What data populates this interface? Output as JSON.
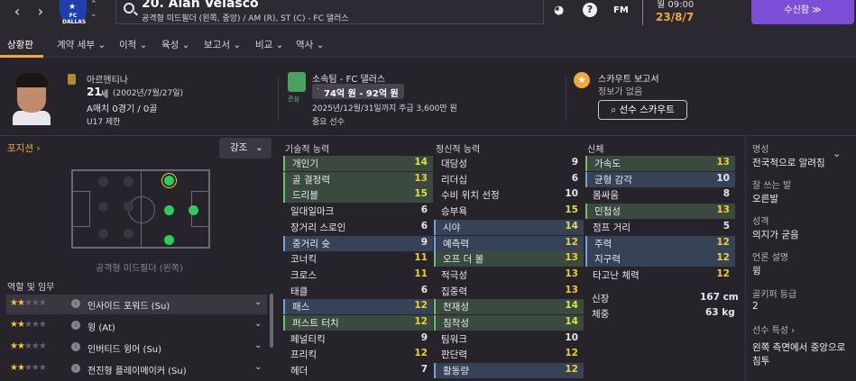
{
  "header": {
    "player_name": "20. Alan Velasco",
    "player_desc": "공격형 미드필더 (왼쪽, 중앙) / AM (R), ST (C) - FC 댈러스",
    "crest_text": "FC DALLAS",
    "fm_label": "FM",
    "date_line1": "월 09:00",
    "date_line2": "23/8/7",
    "inbox_label": "수신함 ≫"
  },
  "tabs": [
    {
      "label": "상황판"
    },
    {
      "label": "계약 세부 ⌄"
    },
    {
      "label": "이적 ⌄"
    },
    {
      "label": "육성 ⌄"
    },
    {
      "label": "보고서 ⌄"
    },
    {
      "label": "비교 ⌄"
    },
    {
      "label": "역사 ⌄"
    }
  ],
  "bio": {
    "nationality": "아르헨티나",
    "age": "21",
    "age_unit": "세",
    "dob": "(2002년/7월/27일)",
    "caps": "A매치 0경기 / 0골",
    "youth": "U17 제한"
  },
  "club": {
    "loan_label": "소속팀 - FC 댈러스",
    "badge_text": "관심",
    "value_dot": "·",
    "value": "74억 원 - 92억 원",
    "contract": "2025년/12월/31일까지 주급 3,600만 원",
    "status": "중요 선수"
  },
  "scout": {
    "title": "스카우트 보고서",
    "status": "정보가 없음",
    "button": "선수 스카우트"
  },
  "position": {
    "heading": "포지션 ›",
    "strength_btn": "강조",
    "label": "공격형 미드필더 (왼쪽)",
    "roles_heading": "역할 및 임무"
  },
  "roles": [
    {
      "name": "인사이드 포워드 (Su)",
      "stars": "2"
    },
    {
      "name": "윙 (At)",
      "stars": "2"
    },
    {
      "name": "인버티드 윙어 (Su)",
      "stars": "2"
    },
    {
      "name": "전진형 플레이메이커 (Su)",
      "stars": "2"
    }
  ],
  "technical": {
    "heading": "기술적 능력",
    "rows": [
      {
        "name": "개인기",
        "value": "14"
      },
      {
        "name": "골 결정력",
        "value": "13"
      },
      {
        "name": "드리블",
        "value": "15"
      },
      {
        "name": "일대일마크",
        "value": "6"
      },
      {
        "name": "장거리 스로인",
        "value": "6"
      },
      {
        "name": "중거리 슛",
        "value": "9"
      },
      {
        "name": "코너킥",
        "value": "11"
      },
      {
        "name": "크로스",
        "value": "11"
      },
      {
        "name": "태클",
        "value": "6"
      },
      {
        "name": "패스",
        "value": "12"
      },
      {
        "name": "퍼스트 터치",
        "value": "12"
      },
      {
        "name": "페널티킥",
        "value": "9"
      },
      {
        "name": "프리킥",
        "value": "12"
      },
      {
        "name": "헤더",
        "value": "7"
      }
    ]
  },
  "mental": {
    "heading": "정신적 능력",
    "rows": [
      {
        "name": "대담성",
        "value": "9"
      },
      {
        "name": "리더십",
        "value": "6"
      },
      {
        "name": "수비 위치 선정",
        "value": "10"
      },
      {
        "name": "승부욕",
        "value": "15"
      },
      {
        "name": "시야",
        "value": "14"
      },
      {
        "name": "예측력",
        "value": "12"
      },
      {
        "name": "오프 더 볼",
        "value": "13"
      },
      {
        "name": "적극성",
        "value": "13"
      },
      {
        "name": "집중력",
        "value": "13"
      },
      {
        "name": "천재성",
        "value": "14"
      },
      {
        "name": "침착성",
        "value": "14"
      },
      {
        "name": "팀워크",
        "value": "10"
      },
      {
        "name": "판단력",
        "value": "12"
      },
      {
        "name": "활동량",
        "value": "12"
      }
    ]
  },
  "physical": {
    "heading": "신체",
    "rows": [
      {
        "name": "가속도",
        "value": "13"
      },
      {
        "name": "균형 감각",
        "value": "10"
      },
      {
        "name": "몸싸움",
        "value": "8"
      },
      {
        "name": "민첩성",
        "value": "13"
      },
      {
        "name": "점프 거리",
        "value": "5"
      },
      {
        "name": "주력",
        "value": "12"
      },
      {
        "name": "지구력",
        "value": "12"
      },
      {
        "name": "타고난 체력",
        "value": "12"
      }
    ],
    "height_label": "신장",
    "height": "167 cm",
    "weight_label": "체중",
    "weight": "63 kg"
  },
  "side": {
    "reputation_label": "명성",
    "reputation": "전국적으로 알려짐",
    "foot_label": "잘 쓰는 발",
    "foot": "오른발",
    "personality_label": "성격",
    "personality": "의지가 굳음",
    "media_label": "언론 설명",
    "media": "윙",
    "gk_label": "골키퍼 등급",
    "gk": "2",
    "traits_label": "선수 특성 ›",
    "traits": "왼쪽 측면에서 중앙으로",
    "traits2": "침투"
  }
}
